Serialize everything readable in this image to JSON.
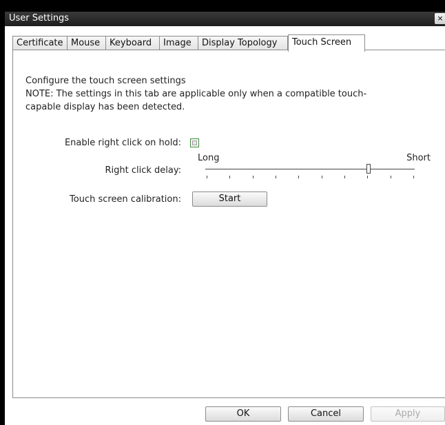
{
  "window": {
    "title": "User Settings",
    "close_glyph": "×"
  },
  "tabs": [
    {
      "label": "Certificate"
    },
    {
      "label": "Mouse"
    },
    {
      "label": "Keyboard"
    },
    {
      "label": "Image"
    },
    {
      "label": "Display Topology"
    },
    {
      "label": "Touch Screen",
      "active": true
    }
  ],
  "touch_screen": {
    "description_line1": "Configure the touch screen settings",
    "description_line2": "NOTE: The settings in this tab are applicable only when a compatible touch-",
    "description_line3": "capable display has been detected.",
    "enable_right_click_label": "Enable right click on hold:",
    "enable_right_click_checked": false,
    "right_click_delay_label": "Right click delay:",
    "slider_min_label": "Long",
    "slider_max_label": "Short",
    "slider_value_fraction": 0.78,
    "slider_tick_count": 10,
    "calibration_label": "Touch screen calibration:",
    "start_button": "Start"
  },
  "footer": {
    "ok": "OK",
    "cancel": "Cancel",
    "apply": "Apply",
    "apply_enabled": false
  },
  "colors": {
    "titlebar": "#2a2a2a",
    "checkbox_border": "#3b8a3b"
  }
}
